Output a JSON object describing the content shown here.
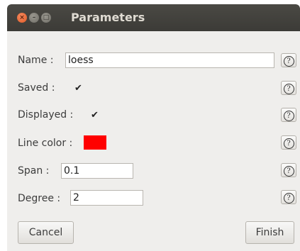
{
  "window": {
    "title": "Parameters",
    "controls": {
      "close": "×",
      "minimize": "–",
      "maximize": "□"
    }
  },
  "fields": {
    "name": {
      "label": "Name  :",
      "value": "loess"
    },
    "saved": {
      "label": "Saved  :",
      "checked": true,
      "mark": "✔"
    },
    "displayed": {
      "label": "Displayed  :",
      "checked": true,
      "mark": "✔"
    },
    "line_color": {
      "label": "Line color  :",
      "color": "#ff0000"
    },
    "span": {
      "label": "Span  :",
      "value": "0.1"
    },
    "degree": {
      "label": "Degree  :",
      "value": "2"
    }
  },
  "help_icon": {
    "name": "help-icon",
    "glyph": "?"
  },
  "buttons": {
    "cancel": "Cancel",
    "finish": "Finish"
  }
}
